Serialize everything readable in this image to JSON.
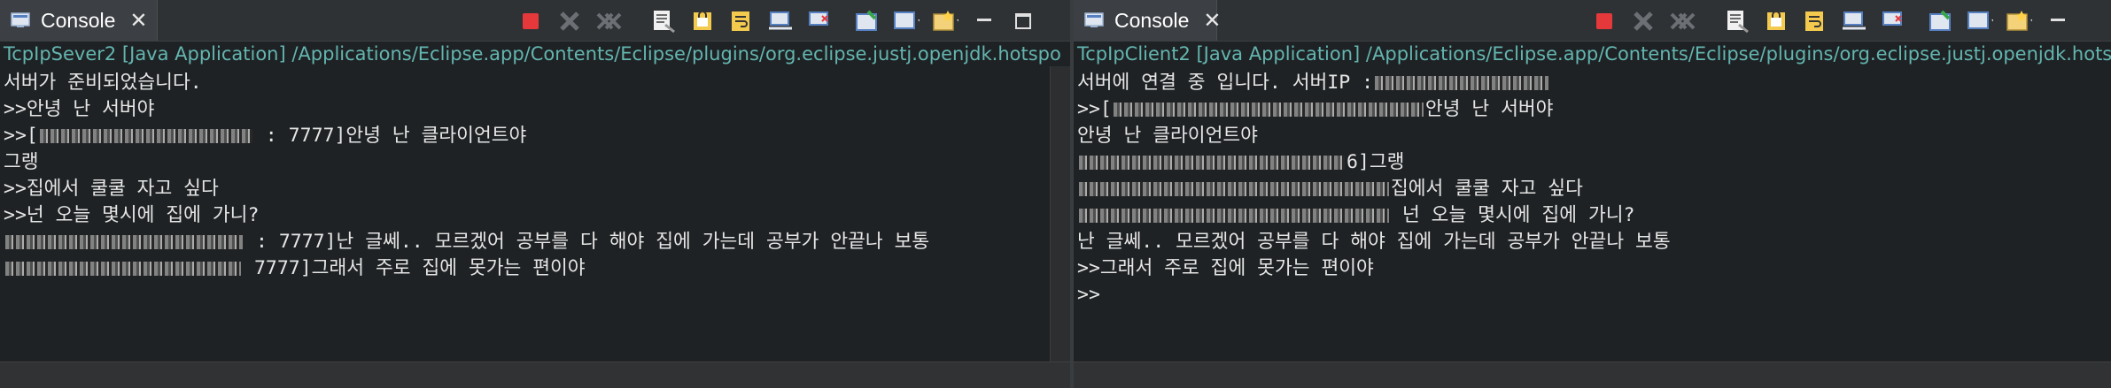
{
  "left": {
    "tab": {
      "label": "Console",
      "icon": "console-icon",
      "close": "✕"
    },
    "process": "TcpIpSever2 [Java Application] /Applications/Eclipse.app/Contents/Eclipse/plugins/org.eclipse.justj.openjdk.hotspo",
    "lines": [
      {
        "pre": "서버가 준비되었습니다.",
        "redact": 0,
        "post": ""
      },
      {
        "pre": ">>안녕 난 서버야",
        "redact": 0,
        "post": ""
      },
      {
        "pre": ">>[",
        "redact": 240,
        "post": " : 7777]안녕 난 클라이언트야"
      },
      {
        "pre": "그랭",
        "redact": 0,
        "post": ""
      },
      {
        "pre": ">>집에서 쿨쿨 자고 싶다",
        "redact": 0,
        "post": ""
      },
      {
        "pre": ">>넌 오늘 몇시에 집에 가니?",
        "redact": 0,
        "post": ""
      },
      {
        "pre": "",
        "redact": 268,
        "post": " : 7777]난 글쎄.. 모르겠어 공부를 다 해야 집에 가는데 공부가 안끝나 보통"
      },
      {
        "pre": "",
        "redact": 266,
        "post": " 7777]그래서 주로 집에 못가는 편이야"
      }
    ]
  },
  "right": {
    "tab": {
      "label": "Console",
      "icon": "console-icon",
      "close": "✕"
    },
    "process": "TcpIpClient2 [Java Application] /Applications/Eclipse.app/Contents/Eclipse/plugins/org.eclipse.justj.openjdk.hotsp",
    "lines": [
      {
        "pre": "서버에 연결 중 입니다. 서버IP :",
        "redact": 196,
        "post": ""
      },
      {
        "pre": ">>[",
        "redact": 350,
        "post": "안녕 난 서버야"
      },
      {
        "pre": "안녕 난 클라이언트야",
        "redact": 0,
        "post": ""
      },
      {
        "pre": "",
        "redact": 300,
        "post": "6]그랭"
      },
      {
        "pre": "",
        "redact": 350,
        "post": "집에서 쿨쿨 자고 싶다"
      },
      {
        "pre": "",
        "redact": 350,
        "post": " 넌 오늘 몇시에 집에 가니?"
      },
      {
        "pre": "난 글쎄.. 모르겠어 공부를 다 해야 집에 가는데 공부가 안끝나 보통",
        "redact": 0,
        "post": ""
      },
      {
        "pre": ">>그래서 주로 집에 못가는 편이야",
        "redact": 0,
        "post": ""
      },
      {
        "pre": ">>",
        "redact": 0,
        "post": ""
      }
    ]
  },
  "toolbar_icons": [
    "terminate-icon",
    "remove-launch-icon",
    "remove-all-terminated-icon",
    "clear-console-icon",
    "scroll-lock-icon",
    "word-wrap-icon",
    "show-on-stdout-icon",
    "show-on-stderr-icon",
    "pin-console-icon",
    "display-selected-console-icon",
    "open-console-icon",
    "minimize-icon",
    "maximize-icon"
  ],
  "colors": {
    "console_bg": "#1f2224",
    "process_text": "#63b5b0",
    "output_text": "#e6e6e6",
    "terminate_red": "#e5383b"
  }
}
